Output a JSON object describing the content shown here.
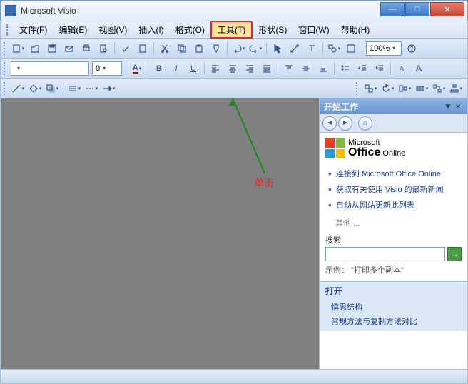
{
  "title": "Microsoft Visio",
  "menu": {
    "file": "文件(F)",
    "edit": "编辑(E)",
    "view": "视图(V)",
    "insert": "插入(I)",
    "format": "格式(O)",
    "tools": "工具(T)",
    "shape": "形状(S)",
    "window": "窗口(W)",
    "help": "帮助(H)"
  },
  "toolbar": {
    "zoom": "100%",
    "fontname": "",
    "fontsize": "0"
  },
  "annotation": "单击",
  "taskpane": {
    "title": "开始工作",
    "office_small": "Microsoft",
    "office_big": "Office",
    "office_suffix": "Online",
    "links": [
      "连接到 Microsoft Office Online",
      "获取有关使用 Visio 的最新新闻",
      "自动从网站更新此列表"
    ],
    "other": "其他 ...",
    "search_label": "搜索:",
    "example": "示例： \"打印多个副本\"",
    "open_header": "打开",
    "open_links": [
      "慎思结构",
      "常规方法与复制方法对比"
    ]
  }
}
